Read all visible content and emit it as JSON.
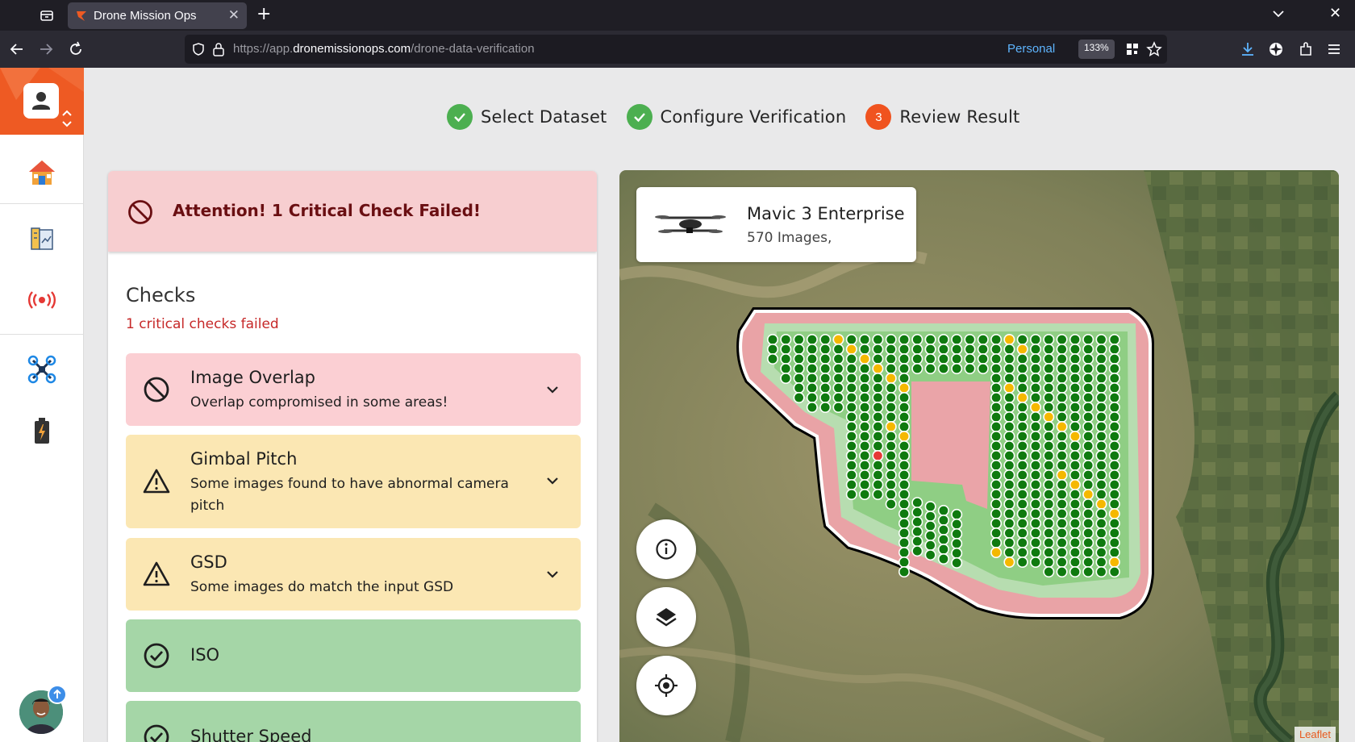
{
  "browser": {
    "tab_title": "Drone Mission Ops",
    "tab_close": "✕",
    "new_tab": "+",
    "url_prefix": "https://app.",
    "url_host": "dronemissionops.com",
    "url_path": "/drone-data-verification",
    "profile_label": "Personal",
    "zoom": "133%",
    "window_close": "✕"
  },
  "sidebar": {
    "items": [
      {
        "icon": "home-icon"
      },
      {
        "icon": "projects-icon"
      },
      {
        "icon": "broadcast-icon"
      },
      {
        "icon": "drone-icon"
      },
      {
        "icon": "battery-icon"
      }
    ]
  },
  "stepper": {
    "steps": [
      {
        "label": "Select Dataset",
        "state": "done"
      },
      {
        "label": "Configure Verification",
        "state": "done"
      },
      {
        "label": "Review Result",
        "state": "active",
        "number": "3"
      }
    ]
  },
  "alert": {
    "text": "Attention! 1 Critical Check Failed!"
  },
  "checks": {
    "title": "Checks",
    "summary": "1 critical checks failed",
    "items": [
      {
        "name": "Image Overlap",
        "description": "Overlap compromised in some areas!",
        "status": "error"
      },
      {
        "name": "Gimbal Pitch",
        "description": "Some images found to have abnormal camera pitch",
        "status": "warning"
      },
      {
        "name": "GSD",
        "description": "Some images do match the input GSD",
        "status": "warning"
      },
      {
        "name": "ISO",
        "description": "",
        "status": "ok"
      },
      {
        "name": "Shutter Speed",
        "description": "",
        "status": "ok"
      }
    ]
  },
  "map": {
    "drone_model": "Mavic 3 Enterprise",
    "image_count": "570 Images,",
    "attribution": "Leaflet",
    "controls": [
      "info-icon",
      "layers-icon",
      "locate-icon"
    ]
  },
  "colors": {
    "brand": "#ee5a23",
    "success": "#4caf50",
    "error_bg": "#fbcfd3",
    "warning_bg": "#fbe7b3",
    "ok_bg": "#a5d6a7",
    "point_ok": "#0f7a0f",
    "point_warn": "#f5b800",
    "point_fail": "#e53935"
  }
}
